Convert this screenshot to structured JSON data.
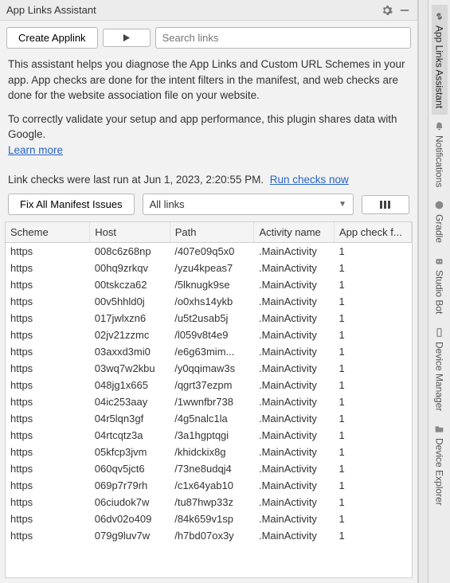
{
  "window": {
    "title": "App Links Assistant"
  },
  "toolbar": {
    "create_label": "Create Applink",
    "search_placeholder": "Search links"
  },
  "description": {
    "p1": "This assistant helps you diagnose the App Links and Custom URL Schemes in your app. App checks are done for the intent filters in the manifest, and web checks are done for the website association file on your website.",
    "p2": "To correctly validate your setup and app performance, this plugin shares data with Google.",
    "learn_more": "Learn more"
  },
  "status": {
    "text": "Link checks were last run at Jun 1, 2023, 2:20:55 PM.",
    "run_link": "Run checks now"
  },
  "controls": {
    "fix_label": "Fix All Manifest Issues",
    "filter_label": "All links"
  },
  "table": {
    "headers": {
      "scheme": "Scheme",
      "host": "Host",
      "path": "Path",
      "activity": "Activity name",
      "appcheck": "App check f..."
    },
    "rows": [
      {
        "scheme": "https",
        "host": "008c6z68np",
        "path": "/407e09q5x0",
        "activity": ".MainActivity",
        "check": "1"
      },
      {
        "scheme": "https",
        "host": "00hq9zrkqv",
        "path": "/yzu4kpeas7",
        "activity": ".MainActivity",
        "check": "1"
      },
      {
        "scheme": "https",
        "host": "00tskcza62",
        "path": "/5lknugk9se",
        "activity": ".MainActivity",
        "check": "1"
      },
      {
        "scheme": "https",
        "host": "00v5hhld0j",
        "path": "/o0xhs14ykb",
        "activity": ".MainActivity",
        "check": "1"
      },
      {
        "scheme": "https",
        "host": "017jwlxzn6",
        "path": "/u5t2usab5j",
        "activity": ".MainActivity",
        "check": "1"
      },
      {
        "scheme": "https",
        "host": "02jv21zzmc",
        "path": "/l059v8t4e9",
        "activity": ".MainActivity",
        "check": "1"
      },
      {
        "scheme": "https",
        "host": "03axxd3mi0",
        "path": "/e6g63mim...",
        "activity": ".MainActivity",
        "check": "1"
      },
      {
        "scheme": "https",
        "host": "03wq7w2kbu",
        "path": "/y0qqimaw3s",
        "activity": ".MainActivity",
        "check": "1"
      },
      {
        "scheme": "https",
        "host": "048jg1x665",
        "path": "/qgrt37ezpm",
        "activity": ".MainActivity",
        "check": "1"
      },
      {
        "scheme": "https",
        "host": "04ic253aay",
        "path": "/1wwnfbr738",
        "activity": ".MainActivity",
        "check": "1"
      },
      {
        "scheme": "https",
        "host": "04r5lqn3gf",
        "path": "/4g5nalc1la",
        "activity": ".MainActivity",
        "check": "1"
      },
      {
        "scheme": "https",
        "host": "04rtcqtz3a",
        "path": "/3a1hgptqgi",
        "activity": ".MainActivity",
        "check": "1"
      },
      {
        "scheme": "https",
        "host": "05kfcp3jvm",
        "path": "/khidckix8g",
        "activity": ".MainActivity",
        "check": "1"
      },
      {
        "scheme": "https",
        "host": "060qv5jct6",
        "path": "/73ne8udqj4",
        "activity": ".MainActivity",
        "check": "1"
      },
      {
        "scheme": "https",
        "host": "069p7r79rh",
        "path": "/c1x64yab10",
        "activity": ".MainActivity",
        "check": "1"
      },
      {
        "scheme": "https",
        "host": "06ciudok7w",
        "path": "/tu87hwp33z",
        "activity": ".MainActivity",
        "check": "1"
      },
      {
        "scheme": "https",
        "host": "06dv02o409",
        "path": "/84k659v1sp",
        "activity": ".MainActivity",
        "check": "1"
      },
      {
        "scheme": "https",
        "host": "079g9luv7w",
        "path": "/h7bd07ox3y",
        "activity": ".MainActivity",
        "check": "1"
      }
    ]
  },
  "rail": {
    "items": [
      {
        "label": "App Links Assistant",
        "icon": "link",
        "active": true
      },
      {
        "label": "Notifications",
        "icon": "bell",
        "active": false
      },
      {
        "label": "Gradle",
        "icon": "elephant",
        "active": false
      },
      {
        "label": "Studio Bot",
        "icon": "bot",
        "active": false
      },
      {
        "label": "Device Manager",
        "icon": "device",
        "active": false
      },
      {
        "label": "Device Explorer",
        "icon": "folder",
        "active": false
      }
    ]
  }
}
